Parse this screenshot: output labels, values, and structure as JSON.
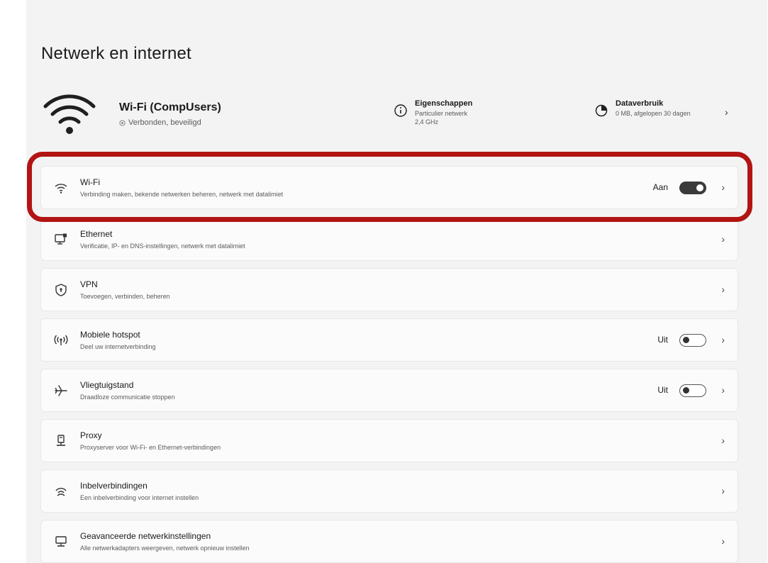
{
  "page": {
    "title": "Netwerk en internet"
  },
  "header": {
    "network_name": "Wi-Fi (CompUsers)",
    "network_status": "Verbonden, beveiligd",
    "properties": {
      "title": "Eigenschappen",
      "line1": "Particulier netwerk",
      "line2": "2,4 GHz"
    },
    "data_usage": {
      "title": "Dataverbruik",
      "subtitle": "0 MB, afgelopen 30 dagen"
    }
  },
  "items": [
    {
      "icon": "wifi-icon",
      "title": "Wi-Fi",
      "subtitle": "Verbinding maken, bekende netwerken beheren, netwerk met datalimiet",
      "state": "Aan",
      "toggle": "on"
    },
    {
      "icon": "ethernet-icon",
      "title": "Ethernet",
      "subtitle": "Verificatie, IP- en DNS-instellingen, netwerk met datalimiet"
    },
    {
      "icon": "vpn-shield-icon",
      "title": "VPN",
      "subtitle": "Toevoegen, verbinden, beheren"
    },
    {
      "icon": "hotspot-icon",
      "title": "Mobiele hotspot",
      "subtitle": "Deel uw internetverbinding",
      "state": "Uit",
      "toggle": "off"
    },
    {
      "icon": "airplane-icon",
      "title": "Vliegtuigstand",
      "subtitle": "Draadloze communicatie stoppen",
      "state": "Uit",
      "toggle": "off"
    },
    {
      "icon": "proxy-icon",
      "title": "Proxy",
      "subtitle": "Proxyserver voor Wi-Fi- en Ethernet-verbindingen"
    },
    {
      "icon": "dialup-icon",
      "title": "Inbelverbindingen",
      "subtitle": "Een inbelverbinding voor internet instellen"
    },
    {
      "icon": "advanced-network-icon",
      "title": "Geavanceerde netwerkinstellingen",
      "subtitle": "Alle netwerkadapters weergeven, netwerk opnieuw instellen"
    }
  ],
  "colors": {
    "highlight": "#b21414",
    "background": "#f3f3f3",
    "card": "#fbfbfb"
  }
}
